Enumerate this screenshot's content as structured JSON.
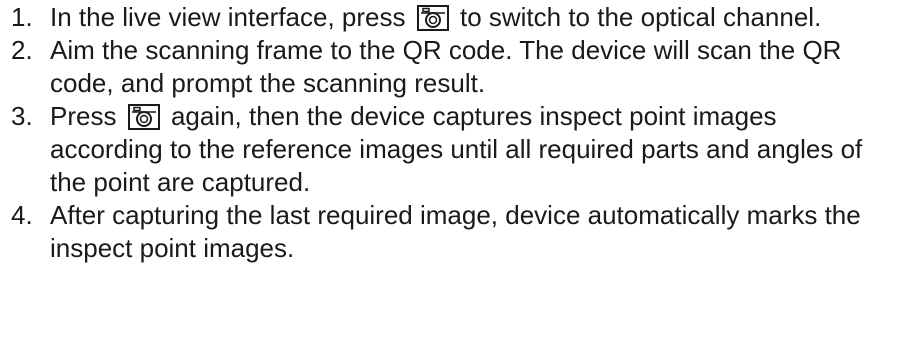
{
  "steps": [
    {
      "number": "1.",
      "before_icon": "In the live view interface, press",
      "icon": "camera-icon",
      "after_icon": "to switch to the optical channel."
    },
    {
      "number": "2.",
      "text": "Aim the scanning frame to the QR code. The device will scan the QR code, and prompt the scanning result."
    },
    {
      "number": "3.",
      "before_icon": "Press",
      "icon": "camera-icon",
      "after_icon": "again, then the device captures inspect point images according to the reference images until all required parts and angles of the point are captured."
    },
    {
      "number": "4.",
      "text": "After capturing the last required image, device automatically marks the inspect point images."
    }
  ]
}
